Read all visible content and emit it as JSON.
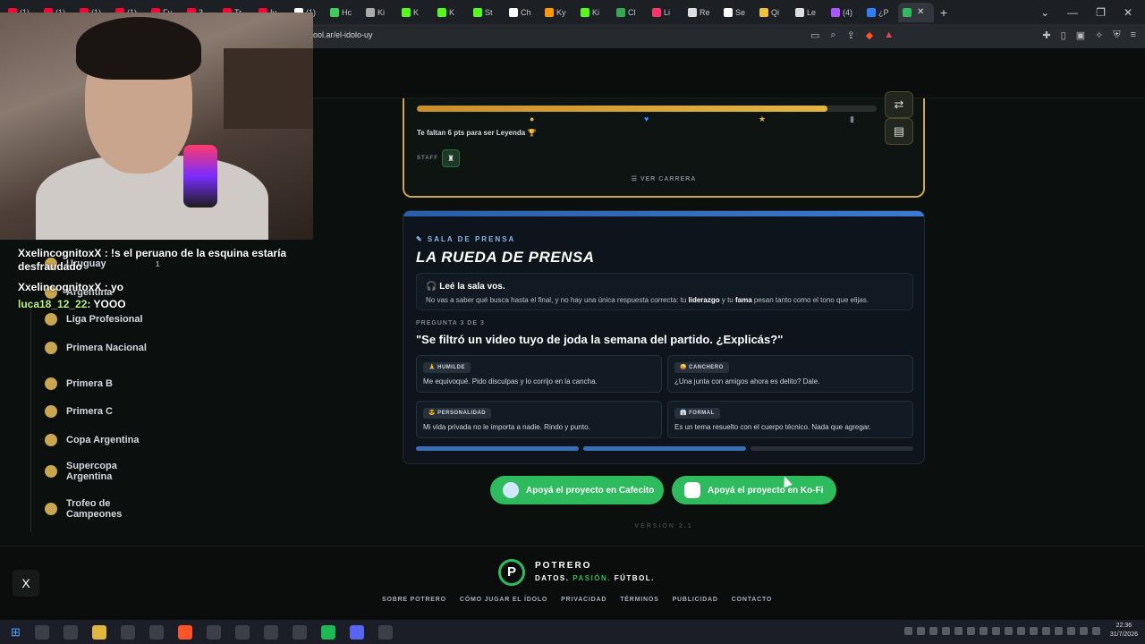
{
  "browser": {
    "tabs": [
      {
        "label": "(1)",
        "color": "#ff0033"
      },
      {
        "label": "(1)",
        "color": "#ff0033"
      },
      {
        "label": "(1)",
        "color": "#ff0033"
      },
      {
        "label": "(1)",
        "color": "#ff0033"
      },
      {
        "label": "Fu",
        "color": "#ff0033"
      },
      {
        "label": "3",
        "color": "#ff0033"
      },
      {
        "label": "Tr",
        "color": "#ff0033"
      },
      {
        "label": "Iv",
        "color": "#ff0033"
      },
      {
        "label": "(1)",
        "color": "#ffffff"
      },
      {
        "label": "Hc",
        "color": "#3ecf5a"
      },
      {
        "label": "Ki",
        "color": "#aaaaaa"
      },
      {
        "label": "K",
        "color": "#53fc18"
      },
      {
        "label": "K",
        "color": "#53fc18"
      },
      {
        "label": "St",
        "color": "#53fc18"
      },
      {
        "label": "Ch",
        "color": "#ffffff"
      },
      {
        "label": "Ky",
        "color": "#ff9900"
      },
      {
        "label": "Ki",
        "color": "#53fc18"
      },
      {
        "label": "Cl",
        "color": "#34a853"
      },
      {
        "label": "Li",
        "color": "#ff3366"
      },
      {
        "label": "Re",
        "color": "#dddddd"
      },
      {
        "label": "Se",
        "color": "#ffffff"
      },
      {
        "label": "Qi",
        "color": "#f0c040"
      },
      {
        "label": "Le",
        "color": "#dddddd"
      },
      {
        "label": "(4)",
        "color": "#aa55ff"
      },
      {
        "label": "¿P",
        "color": "#2d7ff9"
      },
      {
        "label": "",
        "color": "#2dbb5d",
        "active": true
      }
    ],
    "url": "ool.ar/el-idolo-uy"
  },
  "chat": [
    {
      "name": "XxelincognitoxX",
      "text": ": !s el peruano de la esquina estaría desfraudado"
    },
    {
      "name": "XxelincognitoxX",
      "text": ": yo"
    },
    {
      "name": "luca18_12_22",
      "text": ": YOOO"
    }
  ],
  "sidebar": {
    "items": [
      {
        "label": "Uruguay",
        "badge": "1"
      },
      {
        "label": "Argentina"
      },
      {
        "label": "Liga Profesional"
      },
      {
        "label": "Primera Nacional"
      },
      {
        "label": "Primera B"
      },
      {
        "label": "Primera C"
      },
      {
        "label": "Copa Argentina"
      },
      {
        "label": "Supercopa Argentina"
      },
      {
        "label": "Trofeo de Campeones"
      }
    ]
  },
  "career": {
    "progress": 0.893,
    "points_left": "Te faltan 6 pts para ser Leyenda 🏆",
    "staff_label": "STAFF",
    "view_career": "☰ VER CARRERA"
  },
  "press": {
    "kicker": "✎ SALA DE PRENSA",
    "title": "LA RUEDA DE PRENSA",
    "info_title": "🎧 Leé la sala vos.",
    "info_text_1": "No vas a saber qué busca hasta el final, y no hay una única respuesta correcta: tu ",
    "info_bold_1": "liderazgo",
    "info_text_2": " y tu ",
    "info_bold_2": "fama",
    "info_text_3": " pesan tanto como el tono que elijas.",
    "question_number": "PREGUNTA 3 DE 3",
    "question": "\"Se filtró un video tuyo de joda la semana del partido. ¿Explicás?\"",
    "options": [
      {
        "tag": "🙏 HUMILDE",
        "text": "Me equivoqué. Pido disculpas y lo corrijo en la cancha."
      },
      {
        "tag": "😜 CANCHERO",
        "text": "¿Una junta con amigos ahora es delito? Dale."
      },
      {
        "tag": "😎 PERSONALIDAD",
        "text": "Mi vida privada no le importa a nadie. Rindo y punto."
      },
      {
        "tag": "👔 FORMAL",
        "text": "Es un tema resuelto con el cuerpo técnico. Nada que agregar."
      }
    ],
    "progress_colors": [
      "#3a6fb5",
      "#3a6fb5",
      "#2a2f36"
    ]
  },
  "support": {
    "cafecito": "Apoyá el proyecto en Cafecito",
    "kofi": "Apoyá el proyecto en Ko-Fi"
  },
  "version": "VERSIÓN 2.1",
  "footer": {
    "brand": "POTRERO",
    "tag_1": "DATOS. ",
    "tag_2": "PASIÓN.",
    "tag_3": " FÚTBOL.",
    "links": [
      "SOBRE POTRERO",
      "CÓMO JUGAR EL ÍDOLO",
      "PRIVACIDAD",
      "TÉRMINOS",
      "PUBLICIDAD",
      "CONTACTO"
    ],
    "x_label": "X"
  },
  "taskbar": {
    "time": "22:36",
    "date": "31/7/2026"
  }
}
